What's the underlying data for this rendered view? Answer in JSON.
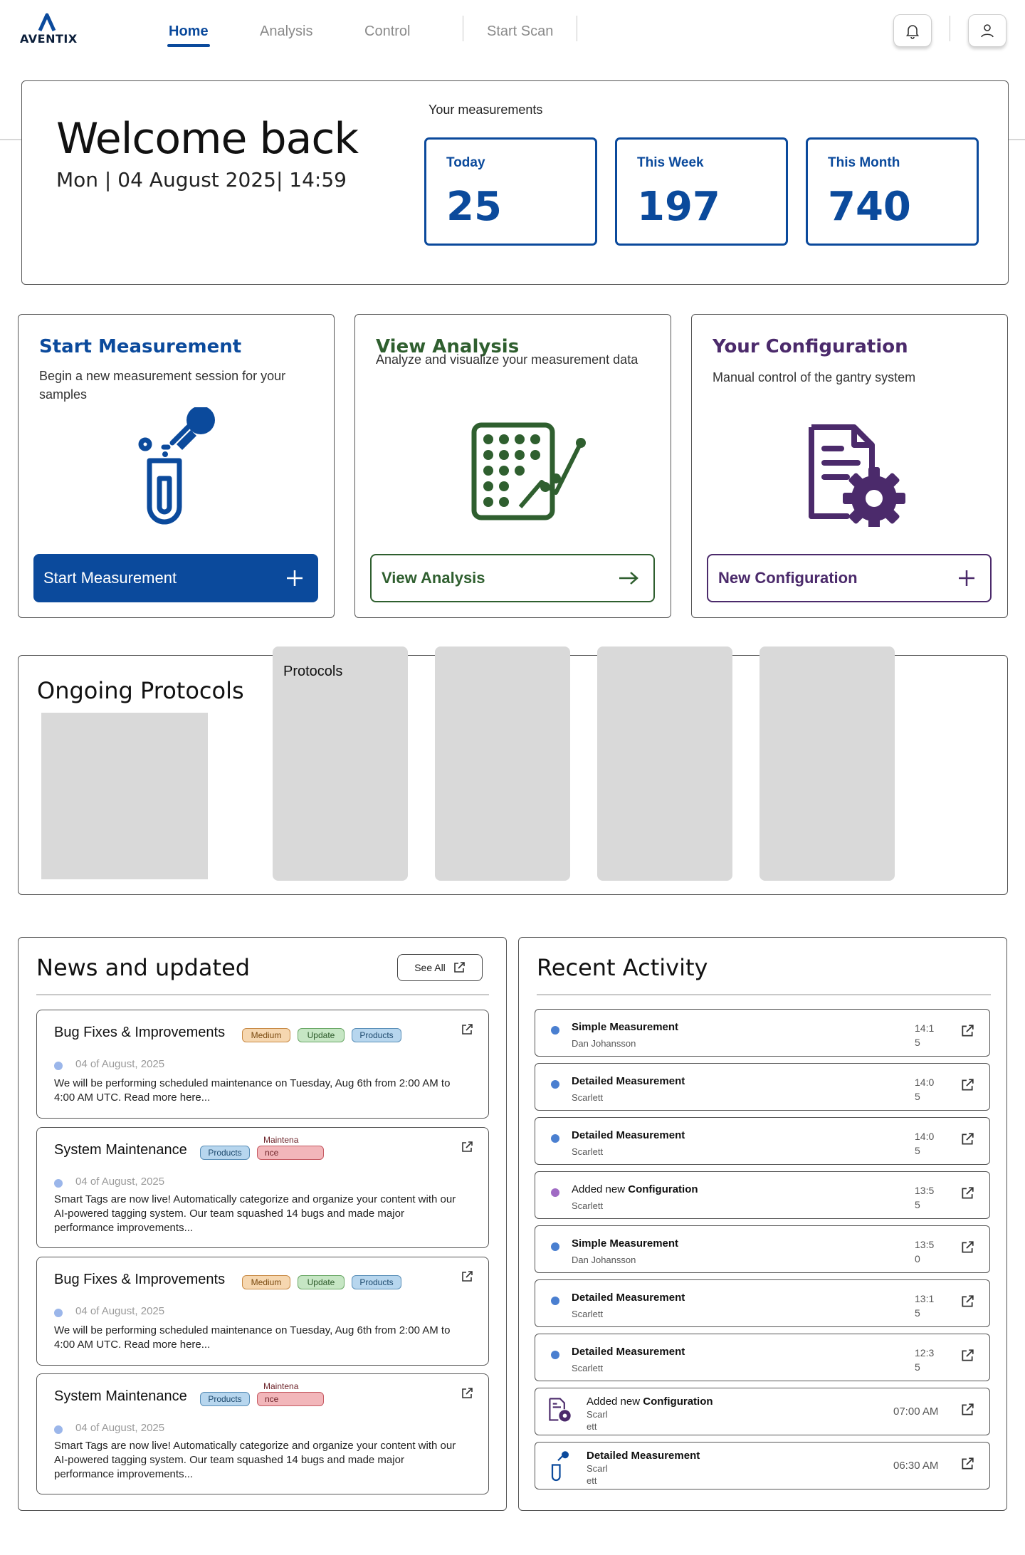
{
  "nav": {
    "logo_text": "AVENTIX",
    "links": [
      "Home",
      "Analysis",
      "Control",
      "Start Scan"
    ]
  },
  "welcome": {
    "title": "Welcome back",
    "date": "Mon  |  04 August 2025|  14:59",
    "measurements_label": "Your measurements",
    "stats": [
      {
        "label": "Today",
        "value": "25"
      },
      {
        "label": "This Week",
        "value": "197"
      },
      {
        "label": "This Month",
        "value": "740"
      }
    ]
  },
  "cards": {
    "measurement": {
      "title": "Start Measurement",
      "desc": "Begin a new measurement session for your samples",
      "button": "Start Measurement",
      "color": "#0b4a9c"
    },
    "analysis": {
      "title": "View Analysis",
      "desc": "Analyze and visualize your measurement data",
      "button": "View Analysis",
      "color": "#2f5f2f"
    },
    "configuration": {
      "title": "Your Configuration",
      "desc": "Manual control of  the gantry system",
      "button": "New Configuration",
      "color": "#4b2a6b"
    }
  },
  "protocols": {
    "title": "Ongoing Protocols",
    "placeholder_label": "Protocols"
  },
  "news": {
    "title": "News and updated",
    "see_all": "See All",
    "items": [
      {
        "title": "Bug Fixes & Improvements",
        "tags": [
          "Medium",
          "Update",
          "Products"
        ],
        "date": "04 of August, 2025",
        "body": "We will be performing scheduled maintenance on Tuesday, Aug 6th from 2:00 AM to 4:00 AM UTC. Read more here..."
      },
      {
        "title": "System Maintenance",
        "tags": [
          "Products"
        ],
        "tag_split": [
          "Maintena",
          "nce"
        ],
        "date": "04 of August, 2025",
        "body": "Smart Tags are now live! Automatically categorize and organize your content with our AI-powered tagging system. Our team squashed 14 bugs and made major performance improvements..."
      },
      {
        "title": "Bug Fixes & Improvements",
        "tags": [
          "Medium",
          "Update",
          "Products"
        ],
        "date": "04 of August, 2025",
        "body": "We will be performing scheduled maintenance on Tuesday, Aug 6th from 2:00 AM to 4:00 AM UTC. Read more here..."
      },
      {
        "title": "System Maintenance",
        "tags": [
          "Products"
        ],
        "tag_split": [
          "Maintena",
          "nce"
        ],
        "date": "04 of August, 2025",
        "body": "Smart Tags are now live! Automatically categorize and organize your content with our AI-powered tagging system. Our team squashed 14 bugs and made major performance improvements..."
      }
    ]
  },
  "activity": {
    "title": "Recent Activity",
    "items": [
      {
        "prefix": "",
        "title": "Simple Measurement",
        "user": "Dan Johansson",
        "time": "14:15",
        "dot": "#4a7fd0"
      },
      {
        "prefix": "",
        "title": "Detailed Measurement",
        "user": "Scarlett",
        "time": "14:05",
        "dot": "#4a7fd0"
      },
      {
        "prefix": "",
        "title": "Detailed Measurement",
        "user": "Scarlett",
        "time": "14:05",
        "dot": "#4a7fd0"
      },
      {
        "prefix": "Added new ",
        "title": "Configuration",
        "user": "Scarlett",
        "time": "13:55",
        "dot": "#a06bc4"
      },
      {
        "prefix": "",
        "title": "Simple Measurement",
        "user": "Dan Johansson",
        "time": "13:50",
        "dot": "#4a7fd0"
      },
      {
        "prefix": "",
        "title": "Detailed Measurement",
        "user": "Scarlett",
        "time": "13:15",
        "dot": "#4a7fd0"
      },
      {
        "prefix": "",
        "title": "Detailed Measurement",
        "user": "Scarlett",
        "time": "12:35",
        "dot": "#4a7fd0"
      },
      {
        "prefix": "Added new ",
        "title": "Configuration",
        "user": "Scarl\nett",
        "time": "07:00 AM",
        "icon": "config-icon"
      },
      {
        "prefix": "",
        "title": "Detailed Measurement",
        "user": "Scarl\nett",
        "time": "06:30 AM",
        "icon": "pipette-tube-icon"
      }
    ]
  },
  "colors": {
    "primary": "#0b4a9c",
    "green": "#2f5f2f",
    "purple": "#4b2a6b"
  }
}
